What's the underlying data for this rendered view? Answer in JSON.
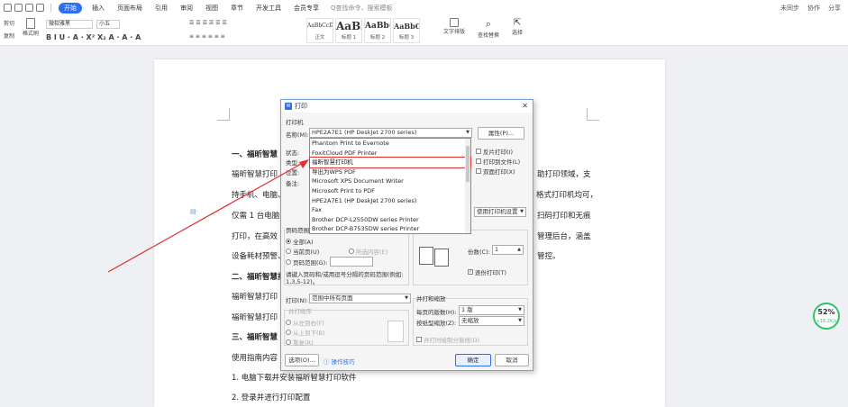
{
  "menubar": {
    "tabs": [
      "开始",
      "插入",
      "页面布局",
      "引用",
      "审阅",
      "视图",
      "章节",
      "开发工具",
      "会员专享"
    ],
    "active_tab": "开始",
    "search": "Q查找命令、搜索模板",
    "right": [
      "未同步",
      "协作",
      "分享"
    ]
  },
  "ribbon": {
    "cut": "剪切",
    "copy": "复制",
    "format_painter": "格式刷",
    "paste": "粘贴",
    "font_name": "微软雅黑",
    "font_size": "小五",
    "styles": [
      {
        "preview": "AaBbCcDd",
        "caption": "正文"
      },
      {
        "preview": "AaBl",
        "caption": "标题 1"
      },
      {
        "preview": "AaBb(",
        "caption": "标题 2"
      },
      {
        "preview": "AaBbC",
        "caption": "标题 3"
      }
    ],
    "text_layout": "文字排版",
    "find_replace": "查找替换",
    "select": "选择"
  },
  "document": {
    "lines": [
      {
        "text": "一、福昕智慧",
        "h": true
      },
      {
        "text": "福昕智慧打印"
      },
      {
        "text": "持手机、电脑、"
      },
      {
        "text": "仅需 1 台电脑"
      },
      {
        "text": "打印，在高效"
      },
      {
        "text": "设备耗材预警、"
      },
      {
        "text": "二、福昕智慧打",
        "h": true
      },
      {
        "text": "福昕智慧打印"
      },
      {
        "text": "福昕智慧打印"
      },
      {
        "text": "三、福昕智慧",
        "h": true
      },
      {
        "text": "使用指南内容"
      },
      {
        "text": "1.  电脑下载并安装福昕智慧打印软件"
      },
      {
        "text": "2.  登录并进行打印配置"
      }
    ],
    "right_fragments": [
      "助打印领域，支",
      "格式打印机均可，",
      "扫码打印和无痕",
      "管理后台，涵盖",
      "管控。"
    ]
  },
  "speed": {
    "percent": "52%",
    "rate": "+16.2K/s"
  },
  "dialog": {
    "title": "打印",
    "printer_group": "打印机",
    "name_label": "名称(M):",
    "name_value": "HPE2A7E1 (HP DeskJet 2700 series)",
    "properties_btn": "属性(P)...",
    "status_label": "状态:",
    "type_label": "类型:",
    "location_label": "位置:",
    "note_label": "备注:",
    "printer_options": [
      "Phantom Print to Evernote",
      "FoxitCloud PDF Printer",
      "福昕智慧打印机",
      "导出为WPS PDF",
      "Microsoft XPS Document Writer",
      "Microsoft Print to PDF",
      "HPE2A7E1 (HP DeskJet 2700 series)",
      "Fax",
      "Brother DCP-L2550DW series Printer",
      "Brother DCP-B7535DW series Printer"
    ],
    "selected_option": "福昕智慧打印机",
    "reverse_print": "反片打印(I)",
    "print_to_file": "打印到文件(L)",
    "duplex": "双面打印(X)",
    "printer_settings": "使用打印机设置",
    "page_range_group": "页码范围",
    "all": "全部(A)",
    "current_page": "当前页(U)",
    "selection": "所选内容(E)",
    "page_range": "页码范围(G):",
    "range_hint": "请键入页码和/或用逗号分隔的页码范围(例如: 1,3,5-12)。",
    "copies_label": "份数(C):",
    "copies": "1",
    "collate": "逐份打印(T)",
    "print_label": "打印(N):",
    "print_value": "范围中所有页面",
    "order_group": "并打顺序",
    "lr": "从左到右(F)",
    "tb": "从上到下(B)",
    "repeat": "重复(R)",
    "zoom_group": "并打和缩放",
    "pages_per_sheet_label": "每页的版数(H):",
    "pages_per_sheet": "1 版",
    "scale_label": "按纸型缩放(Z):",
    "scale": "无缩放",
    "cut_lines": "并打时绘制分割线(D)",
    "options_btn": "选项(O)...",
    "tips": "操作技巧",
    "ok": "确定",
    "cancel": "取消"
  },
  "colors": {
    "accent": "#2b6ff0",
    "annotation": "#e03030",
    "speed": "#2ec26a"
  }
}
